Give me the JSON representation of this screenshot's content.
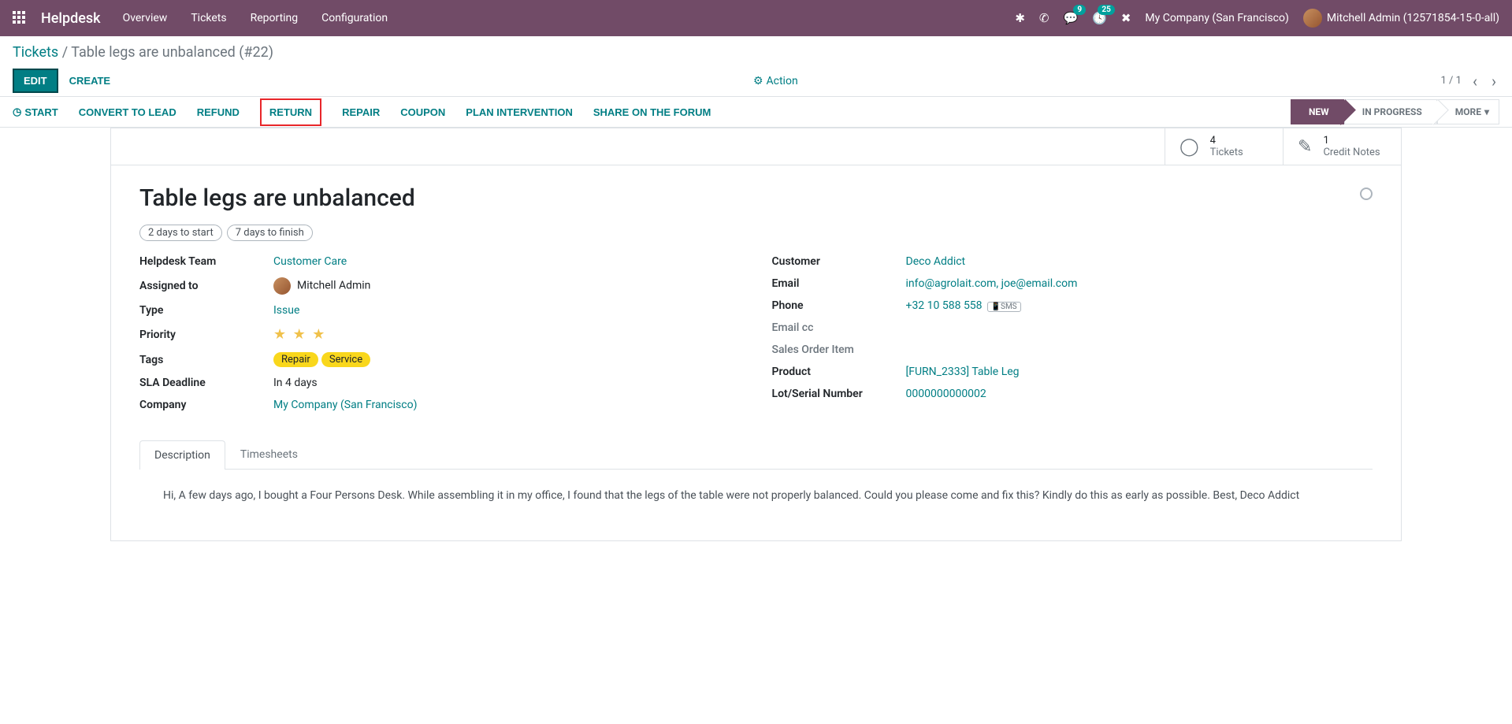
{
  "nav": {
    "app": "Helpdesk",
    "menu": [
      "Overview",
      "Tickets",
      "Reporting",
      "Configuration"
    ],
    "company": "My Company (San Francisco)",
    "user": "Mitchell Admin (12571854-15-0-all)",
    "msg_badge": "9",
    "activity_badge": "25"
  },
  "breadcrumb": {
    "parent": "Tickets",
    "current": "Table legs are unbalanced (#22)"
  },
  "cp": {
    "edit": "EDIT",
    "create": "CREATE",
    "action": "Action",
    "pager": "1 / 1"
  },
  "statusbar": {
    "start": "START",
    "actions": [
      "CONVERT TO LEAD",
      "REFUND",
      "RETURN",
      "REPAIR",
      "COUPON",
      "PLAN INTERVENTION",
      "SHARE ON THE FORUM"
    ],
    "highlighted": "RETURN",
    "stages": {
      "new": "NEW",
      "in_progress": "IN PROGRESS",
      "more": "MORE"
    }
  },
  "stats": {
    "tickets": {
      "n": "4",
      "l": "Tickets"
    },
    "credit": {
      "n": "1",
      "l": "Credit Notes"
    }
  },
  "ticket": {
    "title": "Table legs are unbalanced",
    "pills": [
      "2 days to start",
      "7 days to finish"
    ],
    "left": {
      "team_label": "Helpdesk Team",
      "team": "Customer Care",
      "assigned_label": "Assigned to",
      "assigned": "Mitchell Admin",
      "type_label": "Type",
      "type": "Issue",
      "priority_label": "Priority",
      "tags_label": "Tags",
      "tags": [
        "Repair",
        "Service"
      ],
      "sla_label": "SLA Deadline",
      "sla": "In 4 days",
      "company_label": "Company",
      "company": "My Company (San Francisco)"
    },
    "right": {
      "customer_label": "Customer",
      "customer": "Deco Addict",
      "email_label": "Email",
      "email": "info@agrolait.com, joe@email.com",
      "phone_label": "Phone",
      "phone": "+32 10 588 558",
      "sms": "SMS",
      "emailcc_label": "Email cc",
      "soi_label": "Sales Order Item",
      "product_label": "Product",
      "product": "[FURN_2333] Table Leg",
      "lot_label": "Lot/Serial Number",
      "lot": "0000000000002"
    },
    "tabs": {
      "desc": "Description",
      "ts": "Timesheets"
    },
    "description": "Hi, A few days ago, I bought a Four Persons Desk. While assembling it in my office, I found that the legs of the table were not properly balanced. Could you please come and fix this? Kindly do this as early as possible. Best, Deco Addict"
  }
}
